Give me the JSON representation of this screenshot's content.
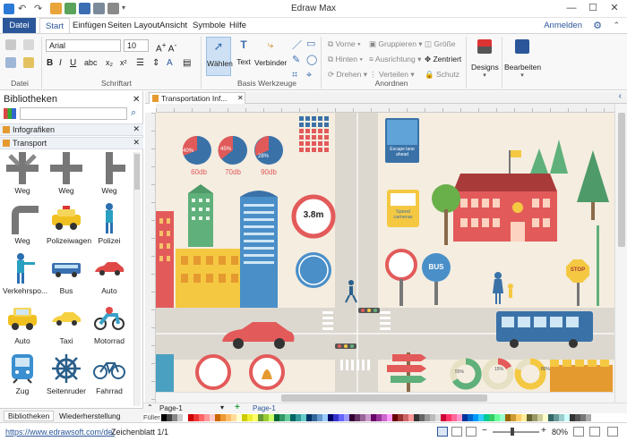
{
  "app": {
    "title": "Edraw Max"
  },
  "quick_access": {
    "undo": "undo-icon",
    "redo": "redo-icon"
  },
  "ribbon_tabs": [
    "Datei",
    "Start",
    "Einfügen",
    "Seiten Layout",
    "Ansicht",
    "Symbole",
    "Hilfe"
  ],
  "account": {
    "login": "Anmelden"
  },
  "ribbon": {
    "font": {
      "name": "Arial",
      "size": "10"
    },
    "groups": {
      "datei": "Datei",
      "schriftart": "Schriftart",
      "basis": "Basis Werkzeuge",
      "anordnen": "Anordnen"
    },
    "tools": {
      "select": "Wählen",
      "text": "Text",
      "connector": "Verbinder"
    },
    "arrange": {
      "front": "Vorne",
      "back": "Hinten",
      "rotate": "Drehen",
      "group": "Gruppieren",
      "align": "Ausrichtung",
      "distribute": "Verteilen",
      "size": "Größe",
      "center": "Zentriert",
      "protect": "Schutz"
    },
    "designs": "Designs",
    "edit": "Bearbeiten"
  },
  "library": {
    "title": "Bibliotheken",
    "categories": [
      "Infografiken",
      "Transport"
    ],
    "shapes": [
      "Weg",
      "Weg",
      "Weg",
      "Weg",
      "Polizeiwagen",
      "Polizei",
      "Verkehrspo...",
      "Bus",
      "Auto",
      "Auto",
      "Taxi",
      "Motorrad",
      "Zug",
      "Seitenruder",
      "Fahrrad"
    ],
    "bottom_tabs": [
      "Bibliotheken",
      "Wiederherstellung"
    ]
  },
  "document": {
    "tab": "Transportation Inf..."
  },
  "pages": {
    "current": "Page-1",
    "tab": "Page-1"
  },
  "canvas_text": {
    "pie1": "60db",
    "pie2": "70db",
    "pie3": "90db",
    "pie1_pct": "40%",
    "pie2_pct": "45%",
    "pie3_pct": "28%",
    "height_sign": "3.8m",
    "escape": "Escape lane ahead",
    "speed": "Speed cameras",
    "bus": "BUS",
    "stop": "STOP",
    "ring1": "55%",
    "ring2": "15%",
    "ring3": "80%"
  },
  "palette_label": "Füller",
  "status": {
    "url": "https://www.edrawsoft.com/de/",
    "sheet": "Zeichenblatt 1/1",
    "zoom": "80%"
  }
}
